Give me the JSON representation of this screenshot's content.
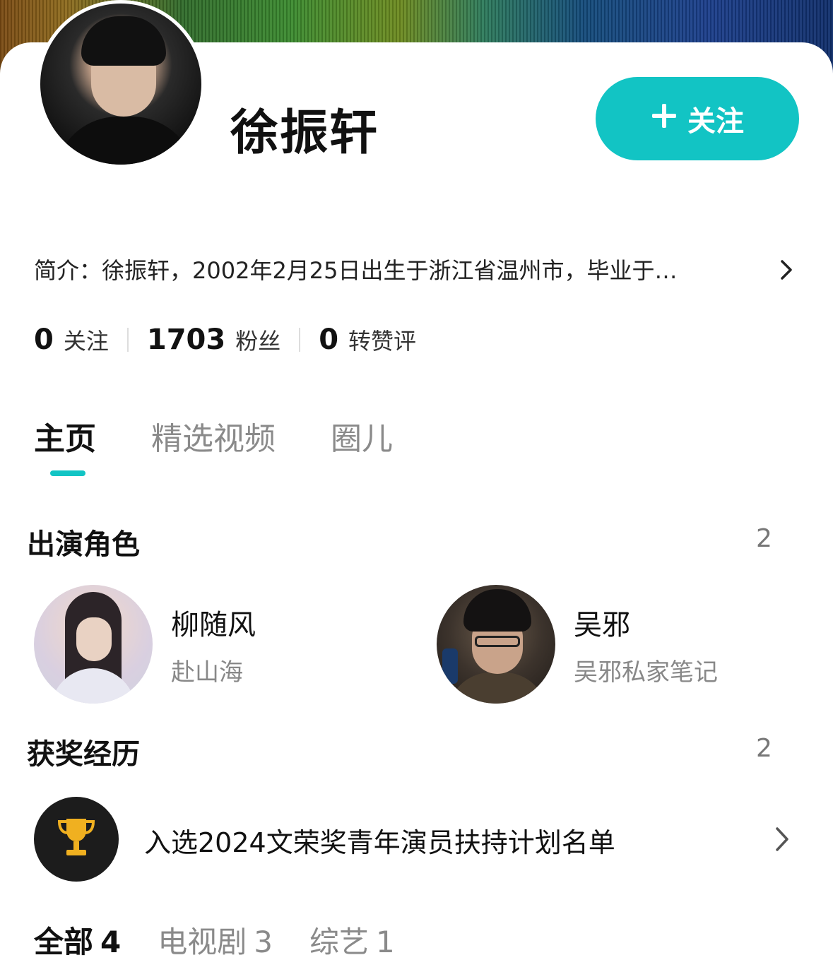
{
  "profile": {
    "name": "徐振轩",
    "follow_label": "关注",
    "intro": "简介：徐振轩，2002年2月25日出生于浙江省温州市，毕业于…"
  },
  "stats": [
    {
      "num": "0",
      "label": "关注"
    },
    {
      "num": "1703",
      "label": "粉丝"
    },
    {
      "num": "0",
      "label": "转赞评"
    }
  ],
  "tabs": [
    "主页",
    "精选视频",
    "圈儿"
  ],
  "roles_section": {
    "title": "出演角色",
    "count": "2",
    "items": [
      {
        "name": "柳随风",
        "show": "赴山海"
      },
      {
        "name": "吴邪",
        "show": "吴邪私家笔记"
      }
    ]
  },
  "awards_section": {
    "title": "获奖经历",
    "count": "2",
    "items": [
      {
        "text": "入选2024文荣奖青年演员扶持计划名单"
      }
    ]
  },
  "filters": [
    {
      "label": "全部",
      "count": "4"
    },
    {
      "label": "电视剧",
      "count": "3"
    },
    {
      "label": "综艺",
      "count": "1"
    }
  ],
  "colors": {
    "accent": "#12c4c4",
    "award_bg": "#1c1c1c",
    "trophy": "#f0b020"
  },
  "icons": {
    "follow": "plus-icon",
    "intro_more": "chevron-right-icon",
    "award": "trophy-icon",
    "award_more": "chevron-right-icon"
  }
}
